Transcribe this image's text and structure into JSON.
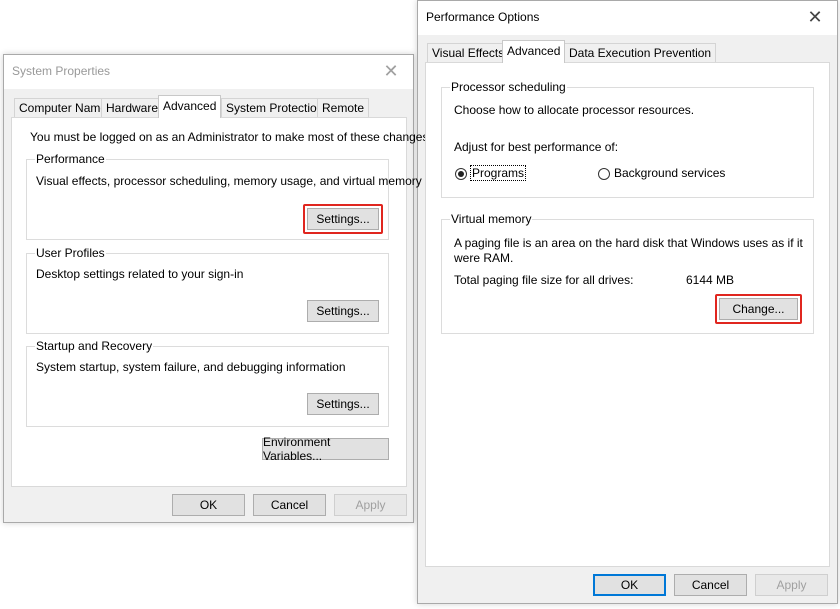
{
  "system_properties": {
    "title": "System Properties",
    "tabs": [
      "Computer Name",
      "Hardware",
      "Advanced",
      "System Protection",
      "Remote"
    ],
    "active_tab": "Advanced",
    "admin_note": "You must be logged on as an Administrator to make most of these changes.",
    "performance": {
      "title": "Performance",
      "description": "Visual effects, processor scheduling, memory usage, and virtual memory",
      "button": "Settings..."
    },
    "user_profiles": {
      "title": "User Profiles",
      "description": "Desktop settings related to your sign-in",
      "button": "Settings..."
    },
    "startup_recovery": {
      "title": "Startup and Recovery",
      "description": "System startup, system failure, and debugging information",
      "button": "Settings..."
    },
    "env_button": "Environment Variables...",
    "ok": "OK",
    "cancel": "Cancel",
    "apply": "Apply"
  },
  "performance_options": {
    "title": "Performance Options",
    "tabs": [
      "Visual Effects",
      "Advanced",
      "Data Execution Prevention"
    ],
    "active_tab": "Advanced",
    "processor_scheduling": {
      "title": "Processor scheduling",
      "description": "Choose how to allocate processor resources.",
      "adjust_label": "Adjust for best performance of:",
      "programs_label": "Programs",
      "background_label": "Background services",
      "selected": "Programs"
    },
    "virtual_memory": {
      "title": "Virtual memory",
      "description_line1": "A paging file is an area on the hard disk that Windows uses as if it",
      "description_line2": "were RAM.",
      "total_label": "Total paging file size for all drives:",
      "total_value": "6144 MB",
      "change_button": "Change..."
    },
    "ok": "OK",
    "cancel": "Cancel",
    "apply": "Apply"
  },
  "colors": {
    "highlight": "#e0261f",
    "accent": "#0078d7"
  }
}
